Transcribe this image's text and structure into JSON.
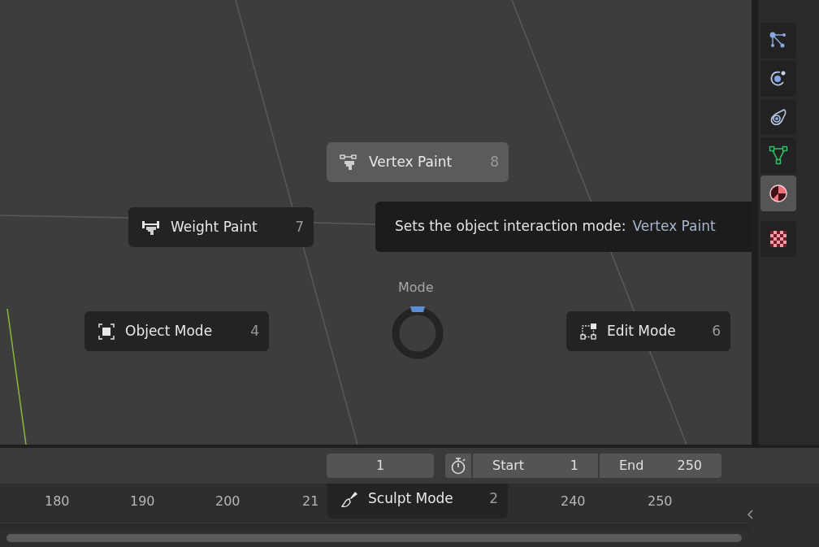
{
  "pie_menu": {
    "title": "Mode",
    "items": [
      {
        "kind": "vertex",
        "label": "Vertex Paint",
        "hotkey": "8",
        "selected": true
      },
      {
        "kind": "weight",
        "label": "Weight Paint",
        "hotkey": "7",
        "selected": false
      },
      {
        "kind": "object",
        "label": "Object Mode",
        "hotkey": "4",
        "selected": false
      },
      {
        "kind": "edit",
        "label": "Edit Mode",
        "hotkey": "6",
        "selected": false
      },
      {
        "kind": "sculpt",
        "label": "Sculpt Mode",
        "hotkey": "2",
        "selected": false
      }
    ]
  },
  "tooltip": {
    "text": "Sets the object interaction mode:",
    "value": "Vertex Paint"
  },
  "properties_tabs": [
    {
      "kind": "particles",
      "selected": false
    },
    {
      "kind": "physics",
      "selected": false
    },
    {
      "kind": "constraints",
      "selected": false
    },
    {
      "kind": "data",
      "selected": false
    },
    {
      "kind": "material",
      "selected": true
    },
    {
      "kind": "texture",
      "selected": false
    }
  ],
  "timeline": {
    "current_frame": "1",
    "start_label": "Start",
    "start": "1",
    "end_label": "End",
    "end": "250",
    "ruler": [
      "180",
      "190",
      "200",
      "21",
      "240",
      "250"
    ]
  }
}
